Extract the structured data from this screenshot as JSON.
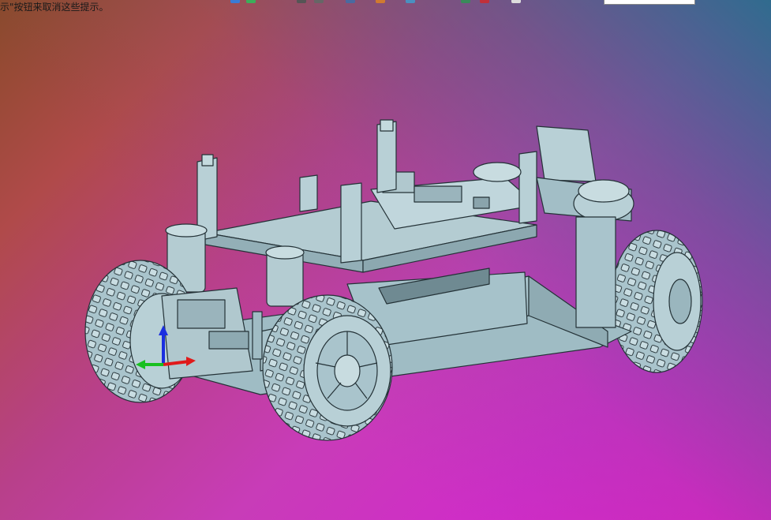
{
  "viewport": {
    "hint_text": "示\"按钮来取消这些提示。",
    "model_color": "#a9c4cc",
    "background_colors": [
      "#8a4a2a",
      "#c83cb8",
      "#2a7896"
    ]
  },
  "toolbar": {
    "icons": [
      "view-icon",
      "render-icon",
      "select-icon",
      "snap-icon",
      "measure-icon",
      "filter-icon",
      "layer-icon",
      "color-icon",
      "close-icon",
      "page-icon"
    ],
    "filter_value": ""
  }
}
